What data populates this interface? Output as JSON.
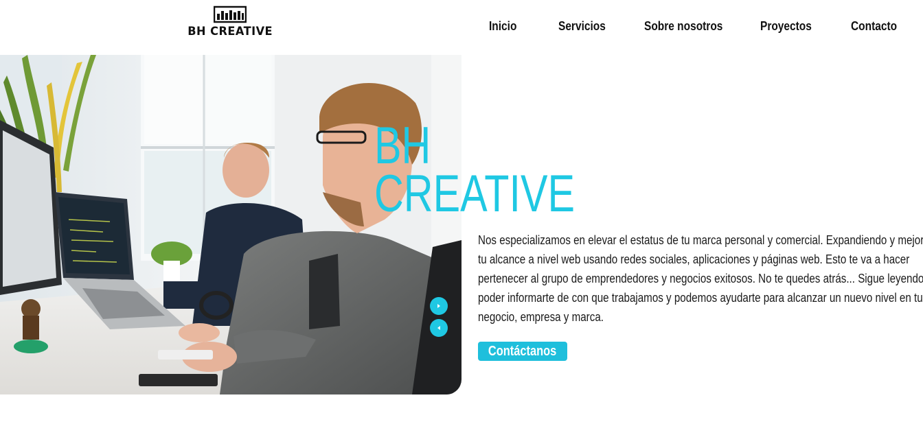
{
  "brand": {
    "name": "BH CREATIVE"
  },
  "nav": {
    "items": [
      {
        "label": "Inicio"
      },
      {
        "label": "Servicios"
      },
      {
        "label": "Sobre nosotros"
      },
      {
        "label": "Proyectos"
      },
      {
        "label": "Contacto"
      }
    ]
  },
  "hero": {
    "title_line1": "BH",
    "title_line2": "CREATIVE",
    "description_lines": [
      "Nos especializamos en elevar el estatus de tu marca personal y comercial. Expandiendo y mejorando",
      "tu alcance a nivel web usando redes sociales, aplicaciones y páginas web. Esto te va a hacer",
      "pertenecer al grupo de emprendedores y negocios exitosos. No te quedes atrás... Sigue leyendo para",
      "poder informarte de con que trabajamos y podemos ayudarte para alcanzar un nuevo nivel en tu",
      "negocio, empresa y marca."
    ],
    "cta_label": "Contáctanos",
    "image_icon": "office-photo-two-men-at-computers"
  },
  "slider": {
    "next_icon": "play-right-icon",
    "prev_icon": "play-left-icon"
  },
  "colors": {
    "accent": "#1fc8e3",
    "button": "#1fbfdc",
    "text": "#111111",
    "background": "#ffffff"
  }
}
